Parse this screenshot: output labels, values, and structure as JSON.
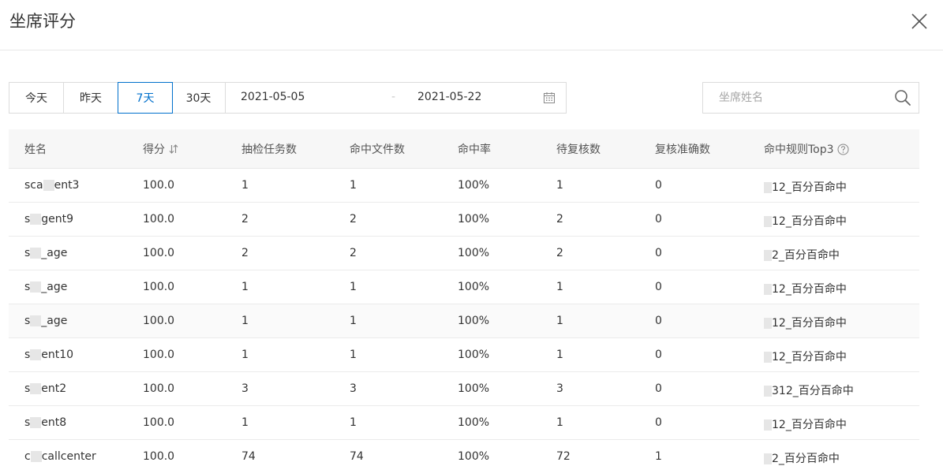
{
  "modal": {
    "title": "坐席评分"
  },
  "toolbar": {
    "ranges": [
      "今天",
      "昨天",
      "7天",
      "30天"
    ],
    "active_range": "7天",
    "date_start": "2021-05-05",
    "date_separator": "-",
    "date_end": "2021-05-22"
  },
  "search": {
    "placeholder": "坐席姓名",
    "value": ""
  },
  "table": {
    "headers": {
      "name": "姓名",
      "score": "得分",
      "tasks": "抽检任务数",
      "hit_files": "命中文件数",
      "hit_rate": "命中率",
      "pending": "待复核数",
      "accuracy": "复核准确数",
      "top3": "命中规则Top3"
    },
    "rows": [
      {
        "name_pre": "sca",
        "name_post": "ent3",
        "score": "100.0",
        "tasks": "1",
        "hit_files": "1",
        "hit_rate": "100%",
        "pending": "1",
        "accuracy": "0",
        "top3": "12_百分百命中"
      },
      {
        "name_pre": "s",
        "name_post": "gent9",
        "score": "100.0",
        "tasks": "2",
        "hit_files": "2",
        "hit_rate": "100%",
        "pending": "2",
        "accuracy": "0",
        "top3": "12_百分百命中"
      },
      {
        "name_pre": "s",
        "name_post": "_age",
        "score": "100.0",
        "tasks": "2",
        "hit_files": "2",
        "hit_rate": "100%",
        "pending": "2",
        "accuracy": "0",
        "top3": "2_百分百命中"
      },
      {
        "name_pre": "s",
        "name_post": "_age",
        "score": "100.0",
        "tasks": "1",
        "hit_files": "1",
        "hit_rate": "100%",
        "pending": "1",
        "accuracy": "0",
        "top3": "12_百分百命中"
      },
      {
        "name_pre": "s",
        "name_post": "_age",
        "score": "100.0",
        "tasks": "1",
        "hit_files": "1",
        "hit_rate": "100%",
        "pending": "1",
        "accuracy": "0",
        "top3": "12_百分百命中"
      },
      {
        "name_pre": "s",
        "name_post": "ent10",
        "score": "100.0",
        "tasks": "1",
        "hit_files": "1",
        "hit_rate": "100%",
        "pending": "1",
        "accuracy": "0",
        "top3": "12_百分百命中"
      },
      {
        "name_pre": "s",
        "name_post": "ent2",
        "score": "100.0",
        "tasks": "3",
        "hit_files": "3",
        "hit_rate": "100%",
        "pending": "3",
        "accuracy": "0",
        "top3": "312_百分百命中"
      },
      {
        "name_pre": "s",
        "name_post": "ent8",
        "score": "100.0",
        "tasks": "1",
        "hit_files": "1",
        "hit_rate": "100%",
        "pending": "1",
        "accuracy": "0",
        "top3": "12_百分百命中"
      },
      {
        "name_pre": "c",
        "name_post": "callcenter",
        "score": "100.0",
        "tasks": "74",
        "hit_files": "74",
        "hit_rate": "100%",
        "pending": "72",
        "accuracy": "1",
        "top3": "2_百分百命中"
      }
    ]
  },
  "colors": {
    "accent": "#0070cc",
    "border": "#dcdcdc",
    "header_bg": "#f7f7f7",
    "text": "#333333"
  },
  "icons": {
    "close": "close-icon",
    "calendar": "calendar-icon",
    "search": "search-icon",
    "sort": "sort-icon",
    "help": "help-icon"
  }
}
